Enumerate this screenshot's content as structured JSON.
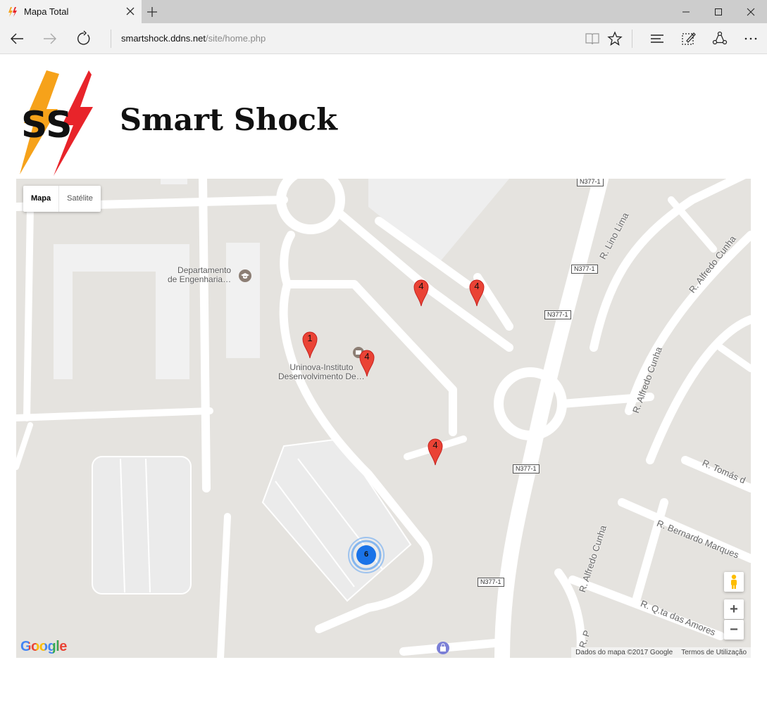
{
  "browser": {
    "tab_title": "Mapa Total",
    "address_host": "smartshock.ddns.net",
    "address_path": "/site/home.php"
  },
  "page": {
    "logo_text": "SS",
    "title": "Smart Shock"
  },
  "map": {
    "type_controls": {
      "map_label": "Mapa",
      "satellite_label": "Satélite",
      "selected": "Mapa"
    },
    "pois": [
      {
        "line1": "Departamento",
        "line2": "de Engenharia…",
        "icon": "school-icon"
      },
      {
        "line1": "Uninova-Instituto",
        "line2": "Desenvolvimento De…",
        "icon": "poi-icon"
      }
    ],
    "markers": [
      {
        "count": "1",
        "color": "#ea4335"
      },
      {
        "count": "4",
        "color": "#ea4335"
      },
      {
        "count": "4",
        "color": "#ea4335"
      },
      {
        "count": "4",
        "color": "#ea4335"
      },
      {
        "count": "4",
        "color": "#ea4335"
      }
    ],
    "cluster": {
      "count": "6",
      "color": "#1a73e8"
    },
    "roads": {
      "lino_lima": "R. Lino Lima",
      "alfredo_cunha_1": "R. Alfredo Cunha",
      "alfredo_cunha_2": "R. Alfredo Cunha",
      "alfredo_cunha_3": "R. Alfredo Cunha",
      "tomas": "R. Tomás d",
      "bernardo": "R. Bernardo Marques",
      "qta_amores": "R. Q.ta das Amores",
      "r_small": "R. P"
    },
    "shields": [
      "N377-1",
      "N377-1",
      "N377-1",
      "N377-1",
      "N377-1"
    ],
    "attribution": {
      "data": "Dados do mapa ©2017 Google",
      "terms": "Termos de Utilização"
    },
    "google_logo": "Google",
    "zoom_in": "+",
    "zoom_out": "−"
  }
}
